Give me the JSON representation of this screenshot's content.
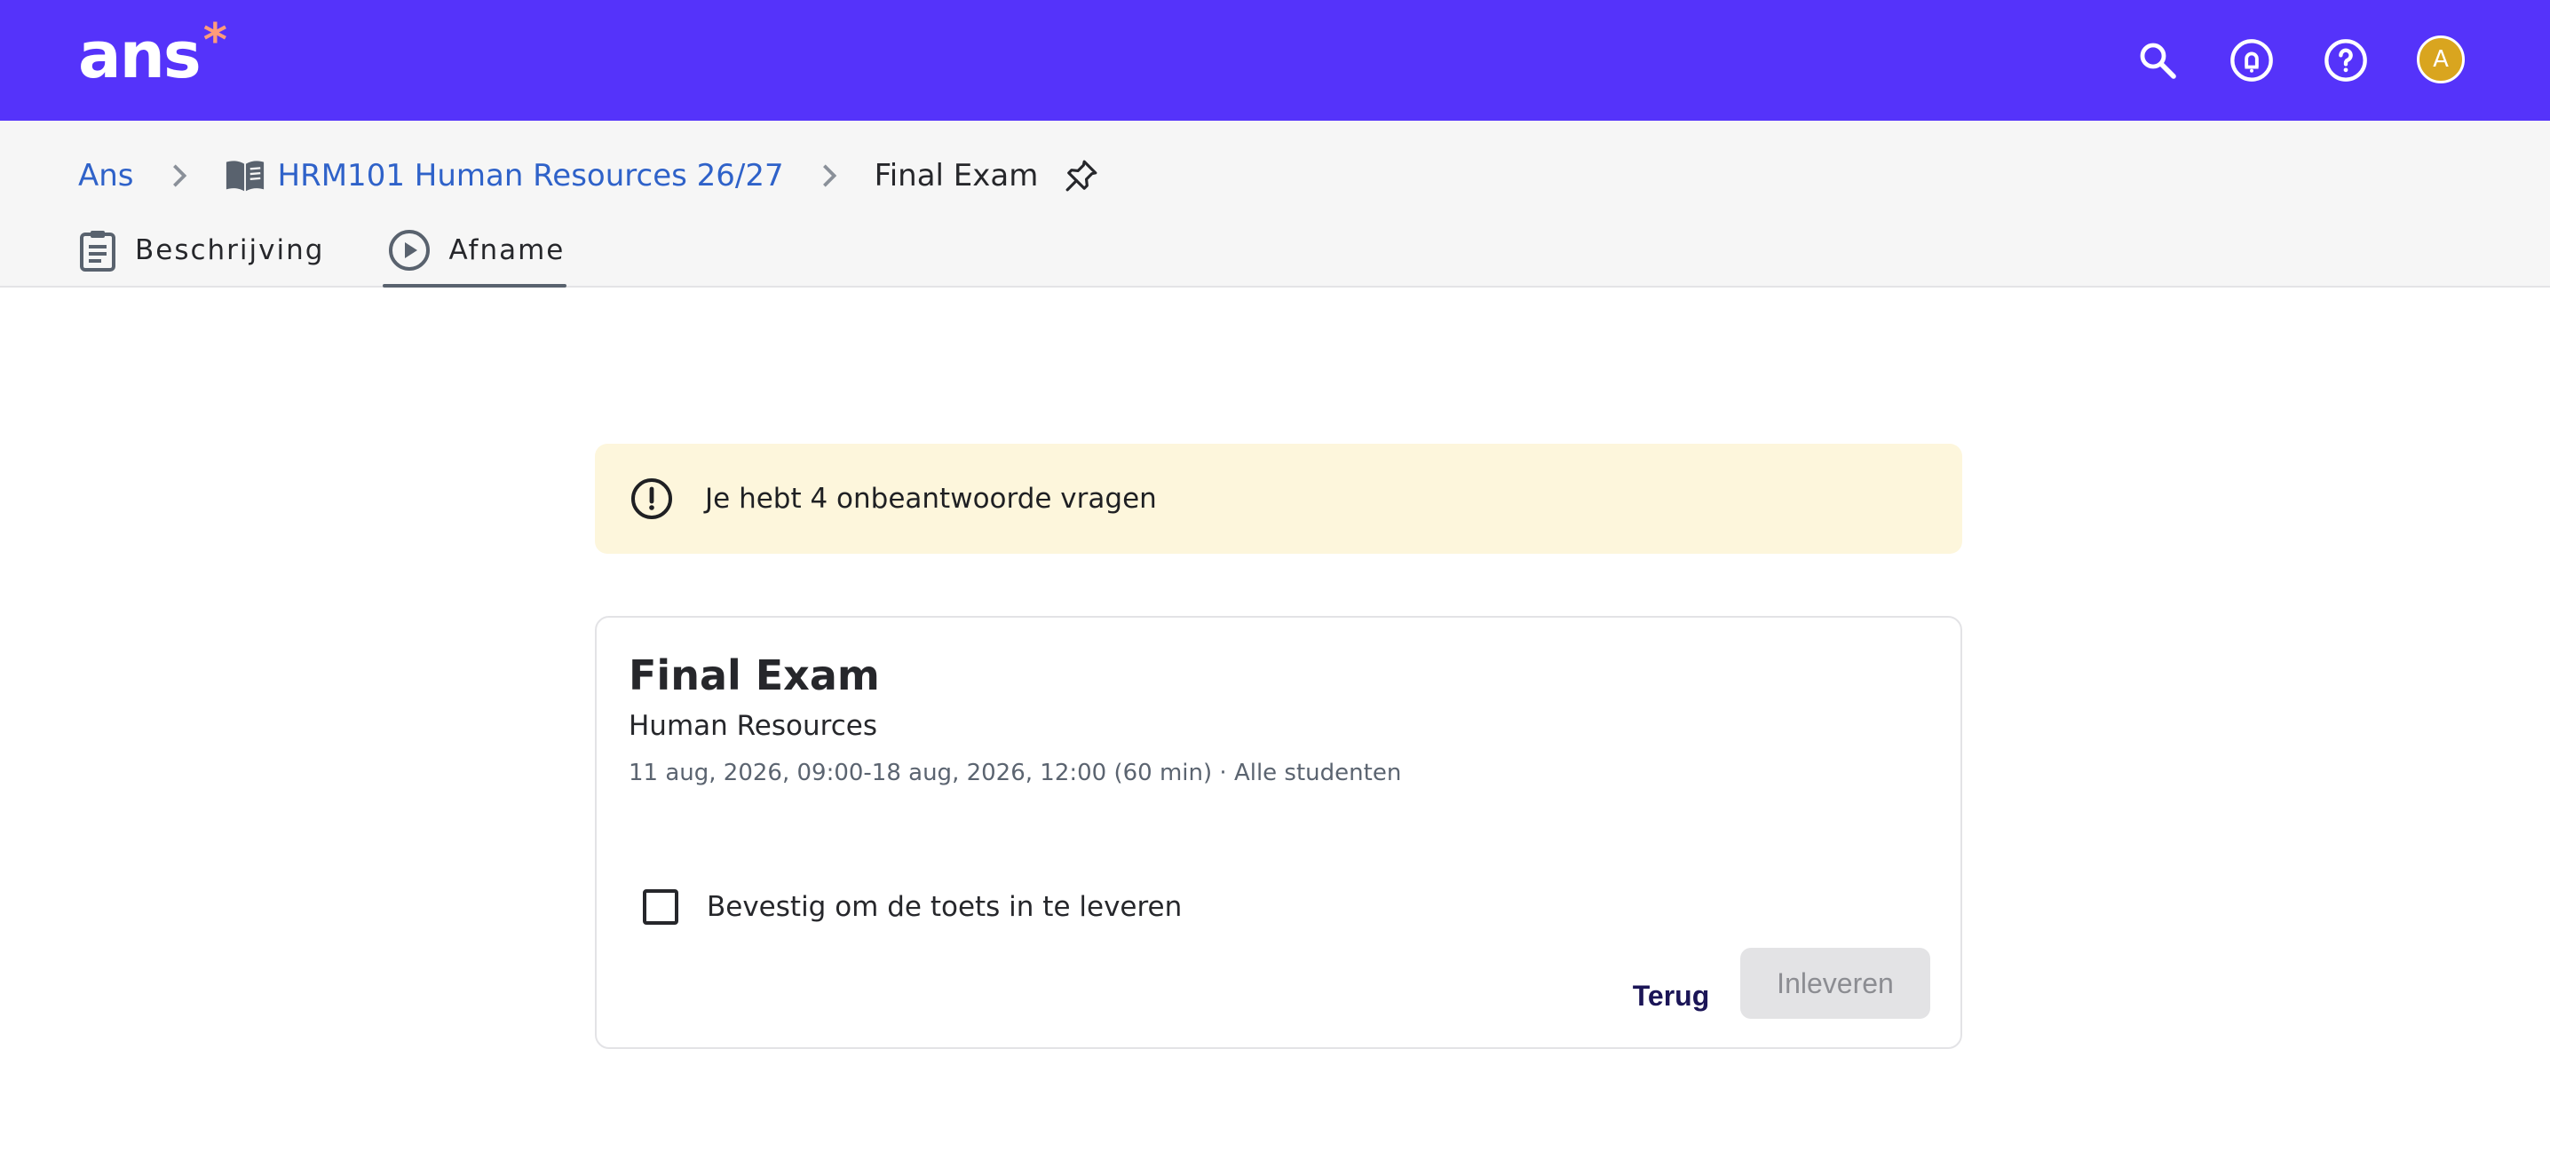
{
  "app": {
    "logo_text": "ans",
    "logo_mark": "*",
    "brand_color": "#5533fa",
    "avatar_initial": "A"
  },
  "topbar": {
    "icons": [
      "search-icon",
      "notification-bell-icon",
      "help-icon"
    ]
  },
  "breadcrumb": {
    "home": "Ans",
    "course": "HRM101 Human Resources 26/27",
    "current": "Final Exam"
  },
  "tabs": [
    {
      "label": "Beschrijving",
      "icon": "clipboard-icon",
      "active": false
    },
    {
      "label": "Afname",
      "icon": "play-circle-icon",
      "active": true
    }
  ],
  "warning": {
    "text": "Je hebt 4 onbeantwoorde vragen",
    "color": "#fdf6dc"
  },
  "exam": {
    "title": "Final Exam",
    "subtitle": "Human Resources",
    "meta": "11 aug, 2026, 09:00-18 aug, 2026, 12:00 (60 min) · Alle studenten",
    "confirm_label": "Bevestig om de toets in te leveren",
    "confirm_checked": false,
    "back_label": "Terug",
    "submit_label": "Inleveren"
  }
}
